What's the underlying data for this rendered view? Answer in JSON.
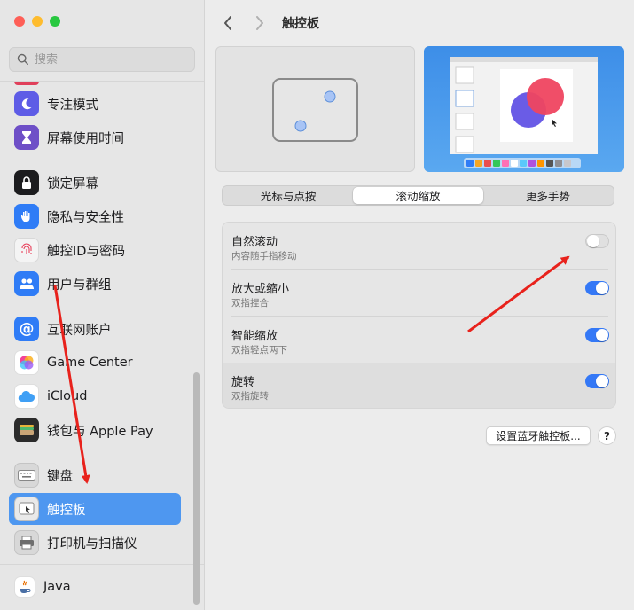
{
  "window": {
    "title": "触控板"
  },
  "search": {
    "placeholder": "搜索"
  },
  "sidebar": {
    "items": [
      {
        "label": "专注模式",
        "icon": "moon-icon",
        "color": "#5e5ce6"
      },
      {
        "label": "屏幕使用时间",
        "icon": "hourglass-icon",
        "color": "#6e4fc7"
      },
      {
        "label": "锁定屏幕",
        "icon": "lock-icon",
        "color": "#1c1c1e"
      },
      {
        "label": "隐私与安全性",
        "icon": "hand-icon",
        "color": "#2f7cf6"
      },
      {
        "label": "触控ID与密码",
        "icon": "fingerprint-icon",
        "color": "#f4f4f4"
      },
      {
        "label": "用户与群组",
        "icon": "users-icon",
        "color": "#2f7cf6"
      },
      {
        "label": "互联网账户",
        "icon": "at-icon",
        "color": "#2f7cf6"
      },
      {
        "label": "Game Center",
        "icon": "game-center-icon",
        "color": "#ffffff"
      },
      {
        "label": "iCloud",
        "icon": "cloud-icon",
        "color": "#ffffff"
      },
      {
        "label": "钱包与 Apple Pay",
        "icon": "wallet-icon",
        "color": "#2b2b2b"
      },
      {
        "label": "键盘",
        "icon": "keyboard-icon",
        "color": "#8e8e93"
      },
      {
        "label": "触控板",
        "icon": "trackpad-icon",
        "color": "#8e8e93"
      },
      {
        "label": "打印机与扫描仪",
        "icon": "printer-icon",
        "color": "#8e8e93"
      },
      {
        "label": "Java",
        "icon": "java-icon",
        "color": "#ffffff"
      }
    ]
  },
  "tabs": [
    {
      "label": "光标与点按"
    },
    {
      "label": "滚动缩放"
    },
    {
      "label": "更多手势"
    }
  ],
  "settings": [
    {
      "title": "自然滚动",
      "subtitle": "内容随手指移动",
      "enabled": false
    },
    {
      "title": "放大或缩小",
      "subtitle": "双指捏合",
      "enabled": true
    },
    {
      "title": "智能缩放",
      "subtitle": "双指轻点两下",
      "enabled": true
    },
    {
      "title": "旋转",
      "subtitle": "双指旋转",
      "enabled": true
    }
  ],
  "buttons": {
    "bluetooth": "设置蓝牙触控板...",
    "help": "?"
  },
  "colors": {
    "accent": "#3478f6",
    "selection": "#4e97f0",
    "annotation": "#e8221c"
  }
}
